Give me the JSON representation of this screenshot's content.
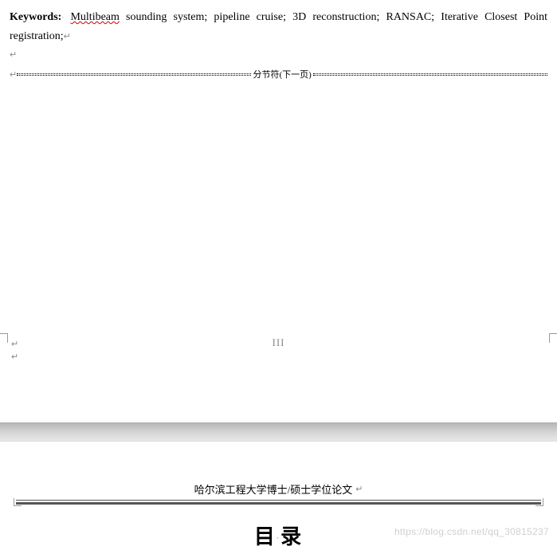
{
  "page1": {
    "keywords_label": "Keywords:",
    "keyword_parts": [
      "Multibeam",
      " sounding system; pipeline cruise; 3D reconstruction; RANSAC; Iterative Closest Point registration;"
    ],
    "section_break_label": "分节符(下一页)",
    "page_number_placeholder": "III",
    "return_mark": "↵",
    "para_mark": "↵"
  },
  "page2": {
    "header_text": "哈尔滨工程大学博士/硕士学位论文",
    "toc_title_char1": "目",
    "toc_title_char2": "录",
    "return_mark": "↵"
  },
  "watermark": {
    "text": "https://blog.csdn.net/qq_30815237"
  },
  "marks": {
    "space_dot": "·"
  }
}
